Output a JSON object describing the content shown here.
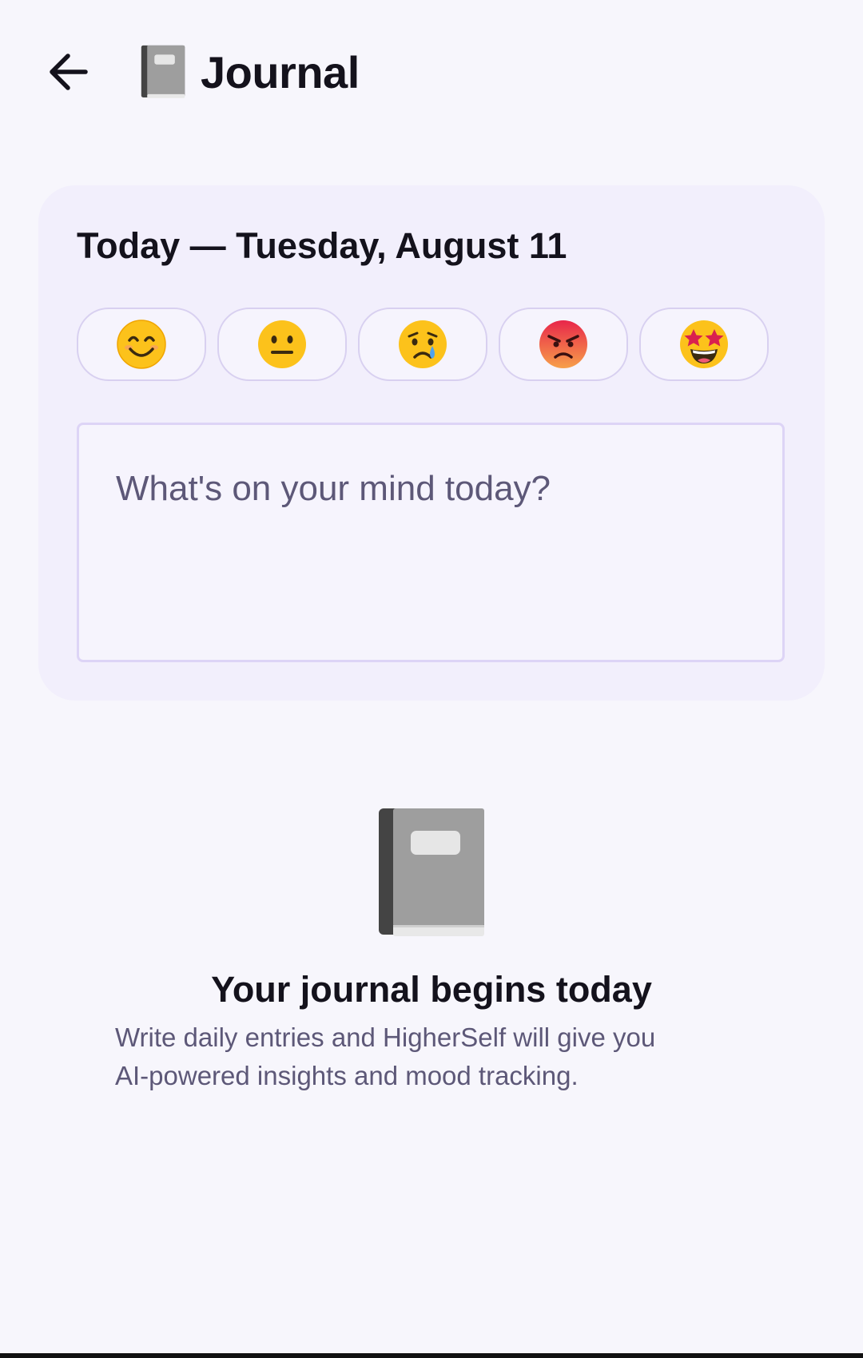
{
  "header": {
    "back_icon": "arrow-left-icon",
    "title_icon": "notebook-emoji",
    "title": "Journal"
  },
  "entry_card": {
    "date_heading": "Today — Tuesday, August 11",
    "moods": [
      {
        "name": "smiling",
        "icon": "smiling-face-icon"
      },
      {
        "name": "neutral",
        "icon": "neutral-face-icon"
      },
      {
        "name": "crying",
        "icon": "crying-face-icon"
      },
      {
        "name": "angry",
        "icon": "angry-face-icon"
      },
      {
        "name": "star-struck",
        "icon": "star-struck-face-icon"
      }
    ],
    "entry_placeholder": "What's on your mind today?",
    "entry_value": ""
  },
  "empty_state": {
    "icon": "notebook-emoji",
    "title": "Your journal begins today",
    "description_line1": "Write daily entries and HigherSelf will give you",
    "description_line2": "AI-powered insights and mood tracking."
  },
  "colors": {
    "background": "#f7f6fc",
    "card": "#f2effc",
    "border": "#d8d0f0",
    "text_primary": "#14121c",
    "text_secondary": "#5d5878"
  }
}
